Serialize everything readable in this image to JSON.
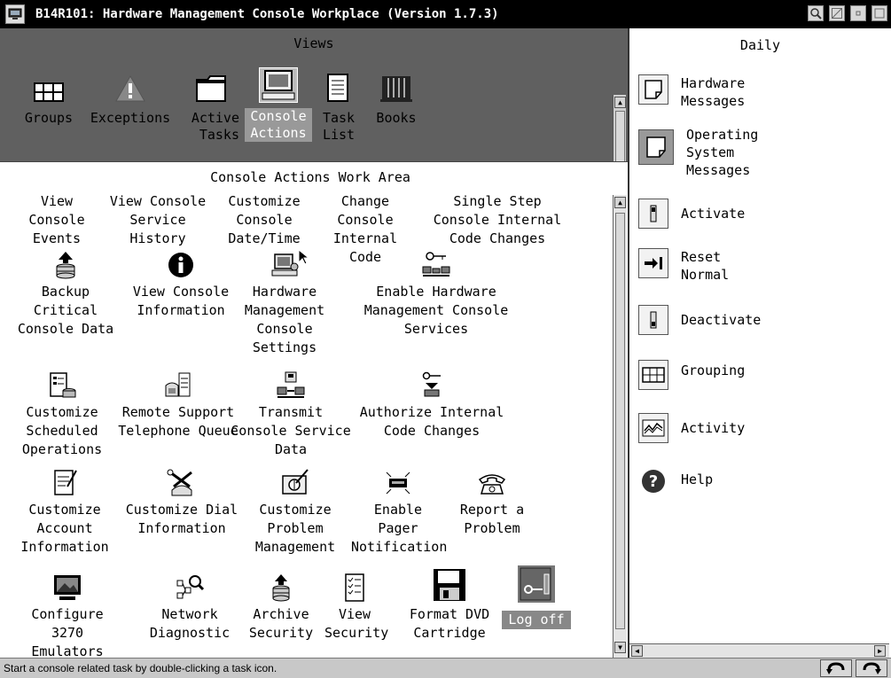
{
  "window": {
    "title": "B14R101: Hardware Management Console Workplace (Version 1.7.3)"
  },
  "views": {
    "title": "Views",
    "items": [
      {
        "label": "Groups",
        "icon": "grid-icon"
      },
      {
        "label": "Exceptions",
        "icon": "warning-icon"
      },
      {
        "label": "Active Tasks",
        "icon": "folder-icon"
      },
      {
        "label": "Console Actions",
        "icon": "monitor-icon",
        "selected": true
      },
      {
        "label": "Task List",
        "icon": "list-icon"
      },
      {
        "label": "Books",
        "icon": "books-icon"
      }
    ]
  },
  "work_area": {
    "title": "Console Actions Work Area",
    "tasks": [
      {
        "label": "View Console Events"
      },
      {
        "label": "View Console Service History"
      },
      {
        "label": "Customize Console Date/Time"
      },
      {
        "label": "Change Console Internal Code"
      },
      {
        "label": "Single Step Console Internal Code Changes"
      },
      {
        "label": "Backup Critical Console Data",
        "icon": "backup-icon"
      },
      {
        "label": "View Console Information",
        "icon": "info-icon"
      },
      {
        "label": "Hardware Management Console Settings",
        "icon": "settings-icon"
      },
      {
        "label": "Enable Hardware Management Console Services",
        "icon": "key-network-icon"
      },
      {
        "label": "Customize Scheduled Operations",
        "icon": "schedule-icon"
      },
      {
        "label": "Remote Support Telephone Queue",
        "icon": "telephone-icon"
      },
      {
        "label": "Transmit Console Service Data",
        "icon": "transmit-icon"
      },
      {
        "label": "Authorize Internal Code Changes",
        "icon": "authorize-icon"
      },
      {
        "label": "Customize Account Information",
        "icon": "notepad-icon"
      },
      {
        "label": "Customize Dial Information",
        "icon": "tools-icon"
      },
      {
        "label": "Customize Problem Management",
        "icon": "problem-icon"
      },
      {
        "label": "Enable Pager Notification",
        "icon": "pager-icon"
      },
      {
        "label": "Report a Problem",
        "icon": "phone-icon"
      },
      {
        "label": "Configure 3270 Emulators",
        "icon": "emulator-icon"
      },
      {
        "label": "Network Diagnostic",
        "icon": "network-icon"
      },
      {
        "label": "Archive Security",
        "icon": "archive-icon"
      },
      {
        "label": "View Security",
        "icon": "checklist-icon"
      },
      {
        "label": "Format DVD Cartridge",
        "icon": "floppy-icon"
      },
      {
        "label": "Log off",
        "icon": "logoff-icon",
        "selected": true
      }
    ]
  },
  "daily": {
    "title": "Daily",
    "items": [
      {
        "label": "Hardware Messages"
      },
      {
        "label": "Operating System Messages",
        "selected": true
      },
      {
        "label": "Activate"
      },
      {
        "label": "Reset Normal"
      },
      {
        "label": "Deactivate"
      },
      {
        "label": "Grouping"
      },
      {
        "label": "Activity"
      },
      {
        "label": "Help"
      }
    ]
  },
  "status_bar": {
    "text": "Start a console related task by double-clicking a task icon."
  }
}
